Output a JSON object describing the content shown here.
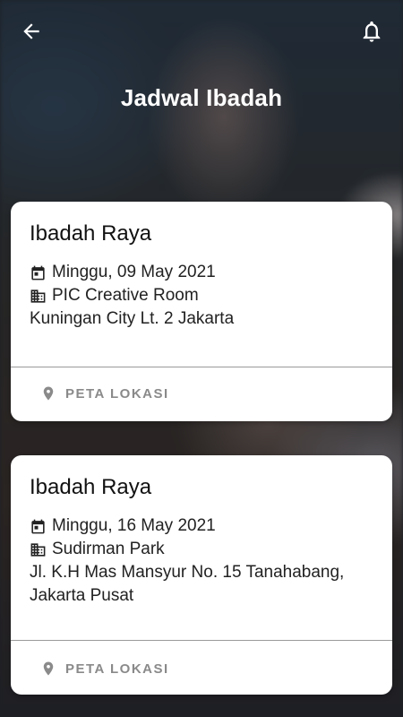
{
  "header": {
    "title": "Jadwal Ibadah",
    "back_icon": "arrow-left-icon",
    "bell_icon": "bell-icon"
  },
  "events": [
    {
      "title": "Ibadah Raya",
      "date": "Minggu, 09 May 2021",
      "venue": "PIC Creative Room",
      "address": "Kuningan City Lt. 2 Jakarta",
      "map_label": "PETA LOKASI"
    },
    {
      "title": "Ibadah Raya",
      "date": "Minggu, 16 May 2021",
      "venue": "Sudirman Park",
      "address": "Jl. K.H Mas Mansyur No. 15 Tanahabang, Jakarta Pusat",
      "map_label": "PETA LOKASI"
    }
  ],
  "colors": {
    "card_bg": "#ffffff",
    "muted": "#8a8a8a",
    "title_text": "#ffffff"
  }
}
